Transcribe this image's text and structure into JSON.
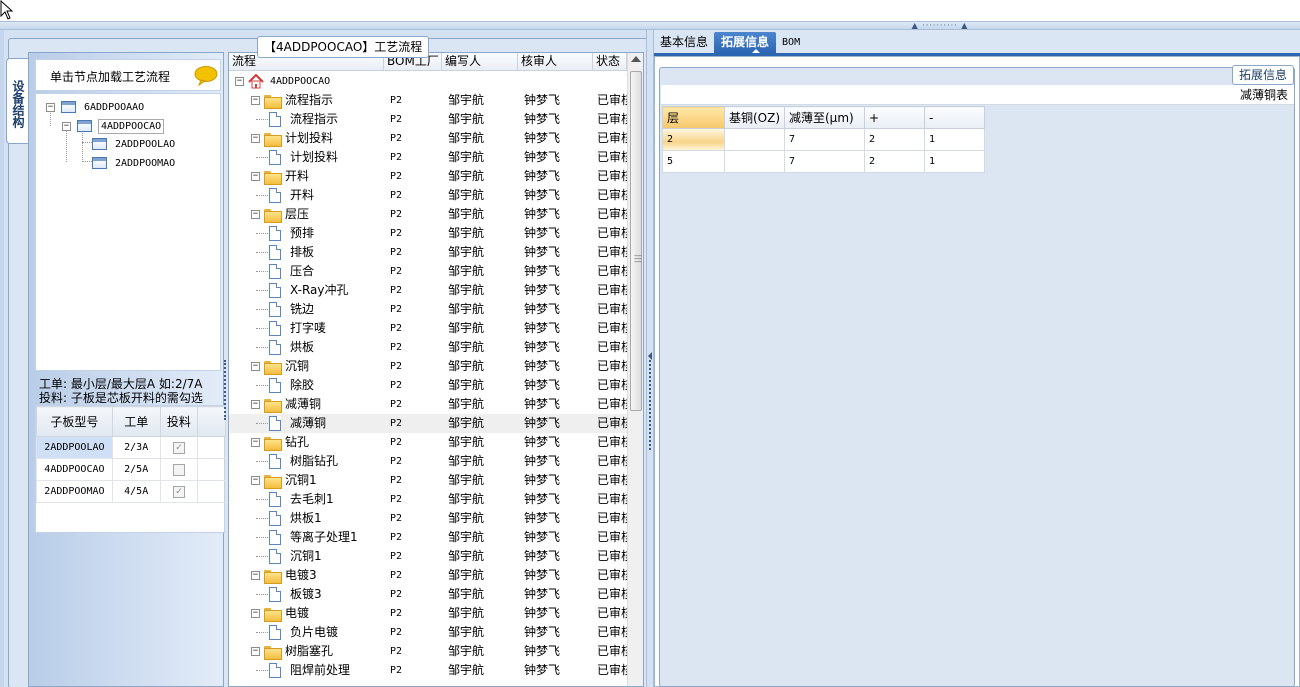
{
  "group_title": "【4ADDPOOCAO】工艺流程",
  "structure": {
    "vertical_tab": "设备结构",
    "header_label": "单击节点加载工艺流程",
    "tree": [
      {
        "label": "6ADDPOOAAO",
        "level": 0,
        "expanded": true
      },
      {
        "label": "4ADDPOOCAO",
        "level": 1,
        "expanded": true,
        "selected": true
      },
      {
        "label": "2ADDPOOLAO",
        "level": 2
      },
      {
        "label": "2ADDPOOMAO",
        "level": 2
      }
    ],
    "info_line1": "工单: 最小层/最大层A 如:2/7A",
    "info_line2": "投料: 子板是芯板开料的需勾选",
    "sub_grid": {
      "headers": [
        "子板型号",
        "工单",
        "投料"
      ],
      "rows": [
        {
          "model": "2ADDPOOLAO",
          "order": "2/3A",
          "feed": true,
          "selected": true
        },
        {
          "model": "4ADDPOOCAO",
          "order": "2/5A",
          "feed": false
        },
        {
          "model": "2ADDPOOMAO",
          "order": "4/5A",
          "feed": true
        }
      ]
    }
  },
  "process": {
    "headers": [
      "流程",
      "BOM工厂",
      "编写人",
      "核审人",
      "状态"
    ],
    "root": "4ADDPOOCAO",
    "rows": [
      {
        "name": "流程指示",
        "kind": "folder",
        "bom": "P2",
        "writer": "邹宇航",
        "checker": "钟梦飞",
        "status": "已审核"
      },
      {
        "name": "流程指示",
        "kind": "doc",
        "bom": "P2",
        "writer": "邹宇航",
        "checker": "钟梦飞",
        "status": "已审核"
      },
      {
        "name": "计划投料",
        "kind": "folder",
        "bom": "P2",
        "writer": "邹宇航",
        "checker": "钟梦飞",
        "status": "已审核"
      },
      {
        "name": "计划投料",
        "kind": "doc",
        "bom": "P2",
        "writer": "邹宇航",
        "checker": "钟梦飞",
        "status": "已审核"
      },
      {
        "name": "开料",
        "kind": "folder",
        "bom": "P2",
        "writer": "邹宇航",
        "checker": "钟梦飞",
        "status": "已审核"
      },
      {
        "name": "开料",
        "kind": "doc",
        "bom": "P2",
        "writer": "邹宇航",
        "checker": "钟梦飞",
        "status": "已审核"
      },
      {
        "name": "层压",
        "kind": "folder",
        "bom": "P2",
        "writer": "邹宇航",
        "checker": "钟梦飞",
        "status": "已审核"
      },
      {
        "name": "预排",
        "kind": "doc",
        "bom": "P2",
        "writer": "邹宇航",
        "checker": "钟梦飞",
        "status": "已审核"
      },
      {
        "name": "排板",
        "kind": "doc",
        "bom": "P2",
        "writer": "邹宇航",
        "checker": "钟梦飞",
        "status": "已审核"
      },
      {
        "name": "压合",
        "kind": "doc",
        "bom": "P2",
        "writer": "邹宇航",
        "checker": "钟梦飞",
        "status": "已审核"
      },
      {
        "name": "X-Ray冲孔",
        "kind": "doc",
        "bom": "P2",
        "writer": "邹宇航",
        "checker": "钟梦飞",
        "status": "已审核"
      },
      {
        "name": "铣边",
        "kind": "doc",
        "bom": "P2",
        "writer": "邹宇航",
        "checker": "钟梦飞",
        "status": "已审核"
      },
      {
        "name": "打字唛",
        "kind": "doc",
        "bom": "P2",
        "writer": "邹宇航",
        "checker": "钟梦飞",
        "status": "已审核"
      },
      {
        "name": "烘板",
        "kind": "doc",
        "bom": "P2",
        "writer": "邹宇航",
        "checker": "钟梦飞",
        "status": "已审核"
      },
      {
        "name": "沉铜",
        "kind": "folder",
        "bom": "P2",
        "writer": "邹宇航",
        "checker": "钟梦飞",
        "status": "已审核"
      },
      {
        "name": "除胶",
        "kind": "doc",
        "bom": "P2",
        "writer": "邹宇航",
        "checker": "钟梦飞",
        "status": "已审核"
      },
      {
        "name": "减薄铜",
        "kind": "folder",
        "bom": "P2",
        "writer": "邹宇航",
        "checker": "钟梦飞",
        "status": "已审核"
      },
      {
        "name": "减薄铜",
        "kind": "doc",
        "bom": "P2",
        "writer": "邹宇航",
        "checker": "钟梦飞",
        "status": "已审核",
        "selected": true
      },
      {
        "name": "钻孔",
        "kind": "folder",
        "bom": "P2",
        "writer": "邹宇航",
        "checker": "钟梦飞",
        "status": "已审核"
      },
      {
        "name": "树脂钻孔",
        "kind": "doc",
        "bom": "P2",
        "writer": "邹宇航",
        "checker": "钟梦飞",
        "status": "已审核"
      },
      {
        "name": "沉铜1",
        "kind": "folder",
        "bom": "P2",
        "writer": "邹宇航",
        "checker": "钟梦飞",
        "status": "已审核"
      },
      {
        "name": "去毛刺1",
        "kind": "doc",
        "bom": "P2",
        "writer": "邹宇航",
        "checker": "钟梦飞",
        "status": "已审核"
      },
      {
        "name": "烘板1",
        "kind": "doc",
        "bom": "P2",
        "writer": "邹宇航",
        "checker": "钟梦飞",
        "status": "已审核"
      },
      {
        "name": "等离子处理1",
        "kind": "doc",
        "bom": "P2",
        "writer": "邹宇航",
        "checker": "钟梦飞",
        "status": "已审核"
      },
      {
        "name": "沉铜1",
        "kind": "doc",
        "bom": "P2",
        "writer": "邹宇航",
        "checker": "钟梦飞",
        "status": "已审核"
      },
      {
        "name": "电镀3",
        "kind": "folder",
        "bom": "P2",
        "writer": "邹宇航",
        "checker": "钟梦飞",
        "status": "已审核"
      },
      {
        "name": "板镀3",
        "kind": "doc",
        "bom": "P2",
        "writer": "邹宇航",
        "checker": "钟梦飞",
        "status": "已审核"
      },
      {
        "name": "电镀",
        "kind": "folder",
        "bom": "P2",
        "writer": "邹宇航",
        "checker": "钟梦飞",
        "status": "已审核"
      },
      {
        "name": "负片电镀",
        "kind": "doc",
        "bom": "P2",
        "writer": "邹宇航",
        "checker": "钟梦飞",
        "status": "已审核"
      },
      {
        "name": "树脂塞孔",
        "kind": "folder",
        "bom": "P2",
        "writer": "邹宇航",
        "checker": "钟梦飞",
        "status": "已审核"
      },
      {
        "name": "阻焊前处理",
        "kind": "doc",
        "bom": "P2",
        "writer": "邹宇航",
        "checker": "钟梦飞",
        "status": "已审核"
      }
    ]
  },
  "right": {
    "tabs": [
      "基本信息",
      "拓展信息",
      "BOM"
    ],
    "active_tab": 1,
    "group_title": "拓展信息",
    "table_caption": "减薄铜表",
    "ext_grid": {
      "headers": [
        "层",
        "基铜(OZ)",
        "减薄至(μm)",
        "+",
        "-"
      ],
      "rows": [
        [
          "2",
          "",
          "7",
          "2",
          "1"
        ],
        [
          "5",
          "",
          "7",
          "2",
          "1"
        ]
      ]
    }
  },
  "colors": {
    "accent": "#2d66b2",
    "panel_bg": "#dbe6f4",
    "folder": "#f3bd3e"
  }
}
